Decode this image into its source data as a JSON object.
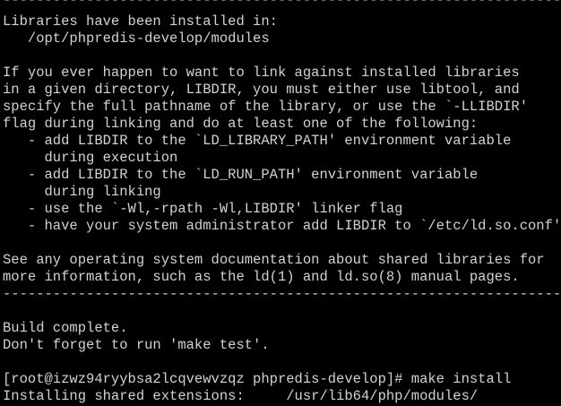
{
  "terminal": {
    "background": "#000000",
    "foreground": "#d2d2d2",
    "lines": [
      "----------------------------------------------------------------------",
      "Libraries have been installed in:",
      "   /opt/phpredis-develop/modules",
      "",
      "If you ever happen to want to link against installed libraries",
      "in a given directory, LIBDIR, you must either use libtool, and",
      "specify the full pathname of the library, or use the `-LLIBDIR'",
      "flag during linking and do at least one of the following:",
      "   - add LIBDIR to the `LD_LIBRARY_PATH' environment variable",
      "     during execution",
      "   - add LIBDIR to the `LD_RUN_PATH' environment variable",
      "     during linking",
      "   - use the `-Wl,-rpath -Wl,LIBDIR' linker flag",
      "   - have your system administrator add LIBDIR to `/etc/ld.so.conf'",
      "",
      "See any operating system documentation about shared libraries for",
      "more information, such as the ld(1) and ld.so(8) manual pages.",
      "----------------------------------------------------------------------",
      "",
      "Build complete.",
      "Don't forget to run 'make test'.",
      "",
      "[root@izwz94ryybsa2lcqvewvzqz phpredis-develop]# make install",
      "Installing shared extensions:     /usr/lib64/php/modules/"
    ]
  }
}
